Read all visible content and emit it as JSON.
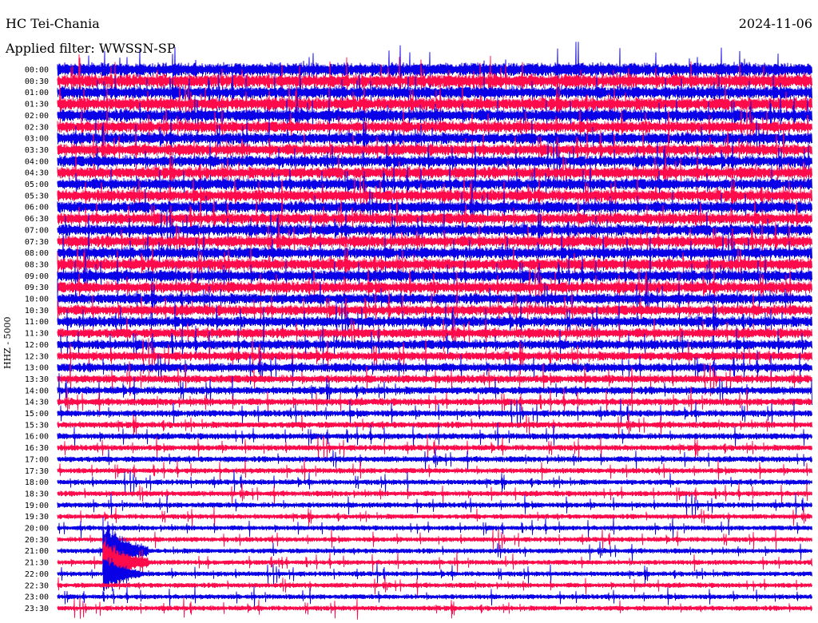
{
  "header": {
    "station": "HC Tei-Chania",
    "date": "2024-11-06",
    "filter_label": "Applied filter: WWSSN-SP"
  },
  "channel_label": "HHZ - 5000",
  "colors": {
    "trace_a": "#0a00e8",
    "trace_b": "#ff0a4a",
    "background": "#ffffff",
    "text": "#000000"
  },
  "chart_data": {
    "type": "line",
    "title": "HC Tei-Chania",
    "subtitle": "Applied filter: WWSSN-SP",
    "date": "2024-11-06",
    "ylabel": "HHZ - 5000",
    "xlabel": "",
    "grid": false,
    "alternating_colors": [
      "#0a00e8",
      "#ff0a4a"
    ],
    "rows": [
      "00:00",
      "00:30",
      "01:00",
      "01:30",
      "02:00",
      "02:30",
      "03:00",
      "03:30",
      "04:00",
      "04:30",
      "05:00",
      "05:30",
      "06:00",
      "06:30",
      "07:00",
      "07:30",
      "08:00",
      "08:30",
      "09:00",
      "09:30",
      "10:00",
      "10:30",
      "11:00",
      "11:30",
      "12:00",
      "12:30",
      "13:00",
      "13:30",
      "14:00",
      "14:30",
      "15:00",
      "15:30",
      "16:00",
      "16:30",
      "17:00",
      "17:30",
      "18:00",
      "18:30",
      "19:00",
      "19:30",
      "20:00",
      "20:30",
      "21:00",
      "21:30",
      "22:00",
      "22:30",
      "23:00",
      "23:30"
    ],
    "row_tick_labels": [
      "00:00",
      "00:30",
      "01:00",
      "01:30",
      "02:00",
      "02:30",
      "03:00",
      "03:30",
      "04:00",
      "04:30",
      "05:00",
      "05:30",
      "06:00",
      "06:30",
      "07:00",
      "07:30",
      "08:00",
      "08:30",
      "09:00",
      "09:30",
      "10:00",
      "10:30",
      "11:00",
      "11:30",
      "12:00",
      "12:30",
      "13:00",
      "13:30",
      "14:00",
      "14:30",
      "15:00",
      "15:30",
      "16:00",
      "16:30",
      "17:00",
      "17:30",
      "18:00",
      "18:30",
      "19:00",
      "19:30",
      "20:00",
      "20:30",
      "21:00",
      "21:30",
      "22:00",
      "22:30",
      "23:00",
      "23:30"
    ],
    "noise_level": [
      1.5,
      1.5,
      1.4,
      1.4,
      1.4,
      1.3,
      1.3,
      1.3,
      1.3,
      1.3,
      1.3,
      1.3,
      1.3,
      1.3,
      1.3,
      1.3,
      1.3,
      1.3,
      1.3,
      1.3,
      1.2,
      1.2,
      1.2,
      1.1,
      1.1,
      1.0,
      1.0,
      0.9,
      0.85,
      0.8,
      0.75,
      0.7,
      0.7,
      0.65,
      0.65,
      0.6,
      0.6,
      0.6,
      0.6,
      0.55,
      0.55,
      0.55,
      0.55,
      0.55,
      0.55,
      0.55,
      0.55,
      0.55
    ],
    "events": [
      {
        "row": "21:00",
        "position": 0.06,
        "duration": 0.06,
        "amplitude": 2.2
      },
      {
        "row": "21:30",
        "position": 0.06,
        "duration": 0.06,
        "amplitude": 1.8
      },
      {
        "row": "22:00",
        "position": 0.06,
        "duration": 0.05,
        "amplitude": 1.4
      }
    ]
  }
}
